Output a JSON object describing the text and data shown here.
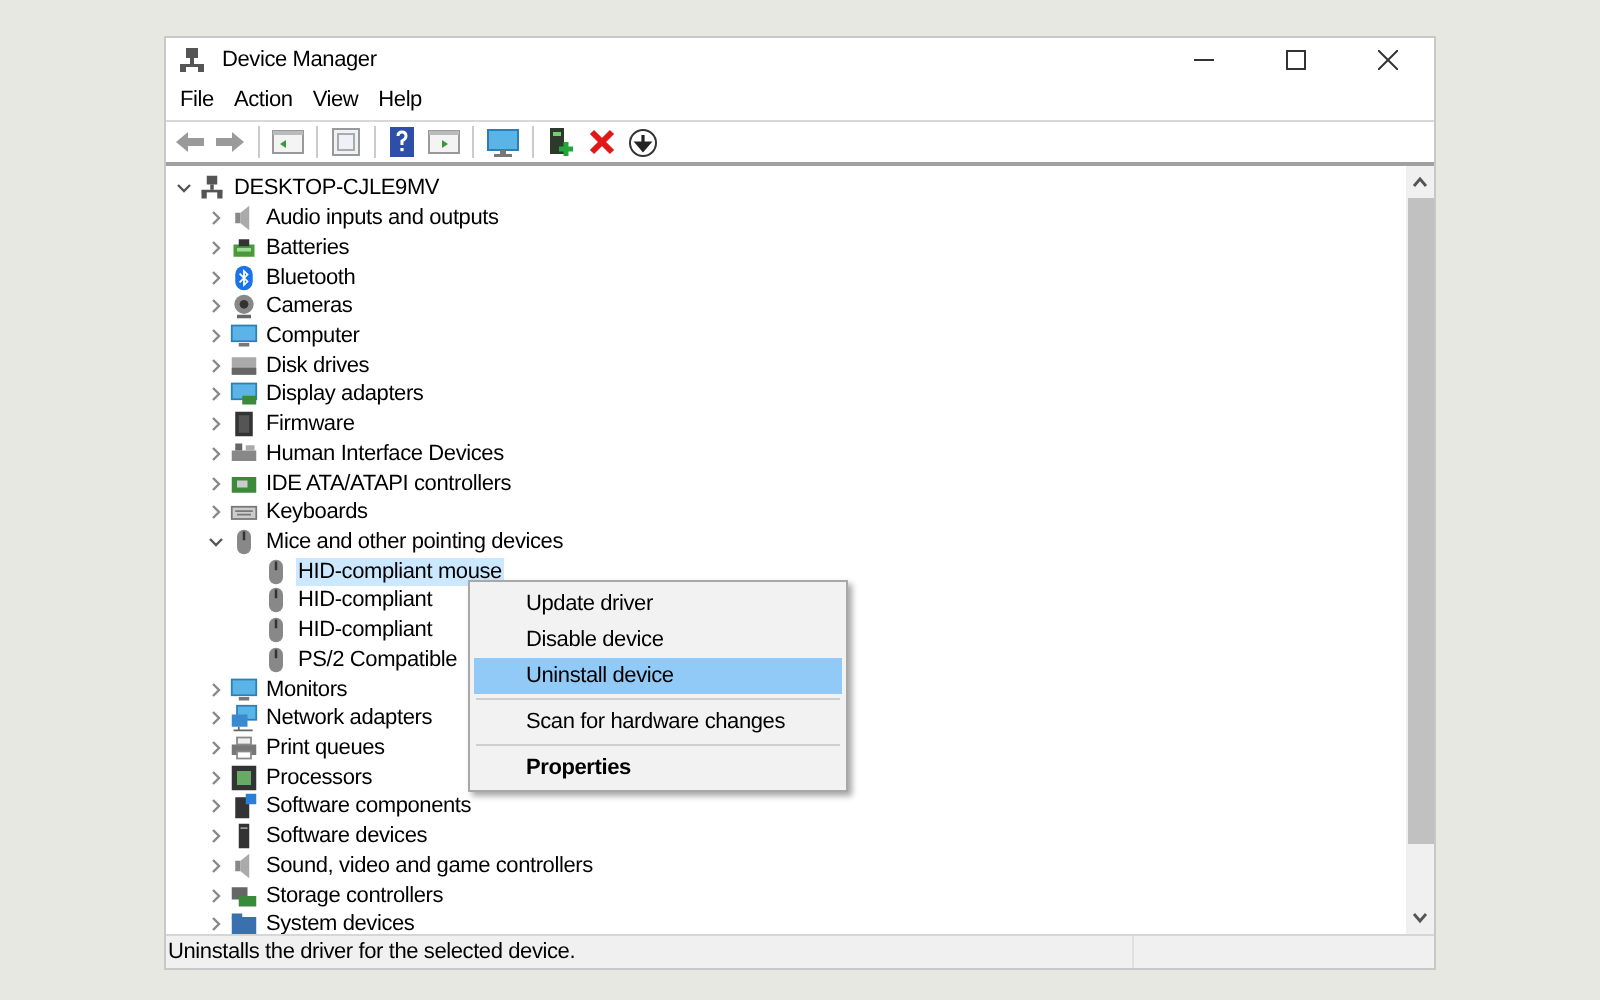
{
  "window": {
    "title": "Device Manager"
  },
  "menu_bar": [
    "File",
    "Action",
    "View",
    "Help"
  ],
  "tree": {
    "label": "DESKTOP-CJLE9MV",
    "expanded": true,
    "selected": false,
    "children": [
      {
        "label": "Audio inputs and outputs",
        "expanded": false,
        "selected": false
      },
      {
        "label": "Batteries",
        "expanded": false,
        "selected": false
      },
      {
        "label": "Bluetooth",
        "expanded": false,
        "selected": false
      },
      {
        "label": "Cameras",
        "expanded": false,
        "selected": false
      },
      {
        "label": "Computer",
        "expanded": false,
        "selected": false
      },
      {
        "label": "Disk drives",
        "expanded": false,
        "selected": false
      },
      {
        "label": "Display adapters",
        "expanded": false,
        "selected": false
      },
      {
        "label": "Firmware",
        "expanded": false,
        "selected": false
      },
      {
        "label": "Human Interface Devices",
        "expanded": false,
        "selected": false
      },
      {
        "label": "IDE ATA/ATAPI controllers",
        "expanded": false,
        "selected": false
      },
      {
        "label": "Keyboards",
        "expanded": false,
        "selected": false
      },
      {
        "label": "Mice and other pointing devices",
        "expanded": true,
        "selected": false,
        "children": [
          {
            "label": "HID-compliant mouse",
            "selected": true
          },
          {
            "label": "HID-compliant",
            "selected": false
          },
          {
            "label": "HID-compliant",
            "selected": false
          },
          {
            "label": "PS/2 Compatible",
            "selected": false
          }
        ]
      },
      {
        "label": "Monitors",
        "expanded": false,
        "selected": false
      },
      {
        "label": "Network adapters",
        "expanded": false,
        "selected": false
      },
      {
        "label": "Print queues",
        "expanded": false,
        "selected": false
      },
      {
        "label": "Processors",
        "expanded": false,
        "selected": false
      },
      {
        "label": "Software components",
        "expanded": false,
        "selected": false
      },
      {
        "label": "Software devices",
        "expanded": false,
        "selected": false
      },
      {
        "label": "Sound, video and game controllers",
        "expanded": false,
        "selected": false
      },
      {
        "label": "Storage controllers",
        "expanded": false,
        "selected": false
      },
      {
        "label": "System devices",
        "expanded": false,
        "selected": false
      }
    ]
  },
  "context_menu": [
    {
      "kind": "item",
      "label": "Update driver",
      "selected": false,
      "default": false
    },
    {
      "kind": "item",
      "label": "Disable device",
      "selected": false,
      "default": false
    },
    {
      "kind": "item",
      "label": "Uninstall device",
      "selected": true,
      "default": false
    },
    {
      "kind": "separator"
    },
    {
      "kind": "item",
      "label": "Scan for hardware changes",
      "selected": false,
      "default": false
    },
    {
      "kind": "separator"
    },
    {
      "kind": "item",
      "label": "Properties",
      "selected": false,
      "default": true
    }
  ],
  "status_bar": {
    "text": "Uninstalls the driver for the selected device."
  }
}
